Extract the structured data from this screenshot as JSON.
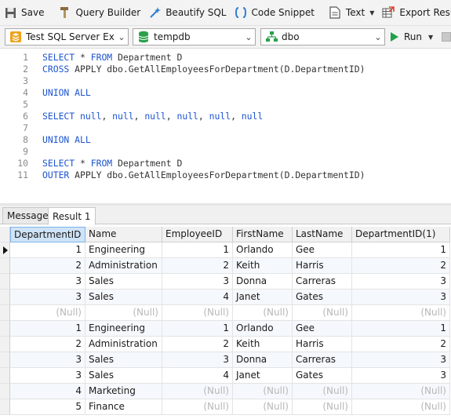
{
  "toolbar": {
    "save": "Save",
    "query_builder": "Query Builder",
    "beautify": "Beautify SQL",
    "code_snippet": "Code Snippet",
    "text": "Text",
    "export_result": "Export Result"
  },
  "connection": {
    "server": "Test SQL Server Expres",
    "database": "tempdb",
    "schema": "dbo",
    "run": "Run"
  },
  "editor": {
    "lines": [
      {
        "n": "1",
        "code": "SELECT * FROM Department D"
      },
      {
        "n": "2",
        "code": "CROSS APPLY dbo.GetAllEmployeesForDepartment(D.DepartmentID)"
      },
      {
        "n": "3",
        "code": ""
      },
      {
        "n": "4",
        "code": "UNION ALL"
      },
      {
        "n": "5",
        "code": ""
      },
      {
        "n": "6",
        "code": "SELECT null, null, null, null, null, null"
      },
      {
        "n": "7",
        "code": ""
      },
      {
        "n": "8",
        "code": "UNION ALL"
      },
      {
        "n": "9",
        "code": ""
      },
      {
        "n": "10",
        "code": "SELECT * FROM Department D"
      },
      {
        "n": "11",
        "code": "OUTER APPLY dbo.GetAllEmployeesForDepartment(D.DepartmentID)"
      }
    ]
  },
  "tabs": {
    "message": "Message",
    "result": "Result 1"
  },
  "grid": {
    "columns": [
      "DepartmentID",
      "Name",
      "EmployeeID",
      "FirstName",
      "LastName",
      "DepartmentID(1)"
    ],
    "rows": [
      [
        "1",
        "Engineering",
        "1",
        "Orlando",
        "Gee",
        "1"
      ],
      [
        "2",
        "Administration",
        "2",
        "Keith",
        "Harris",
        "2"
      ],
      [
        "3",
        "Sales",
        "3",
        "Donna",
        "Carreras",
        "3"
      ],
      [
        "3",
        "Sales",
        "4",
        "Janet",
        "Gates",
        "3"
      ],
      [
        "(Null)",
        "(Null)",
        "(Null)",
        "(Null)",
        "(Null)",
        "(Null)"
      ],
      [
        "1",
        "Engineering",
        "1",
        "Orlando",
        "Gee",
        "1"
      ],
      [
        "2",
        "Administration",
        "2",
        "Keith",
        "Harris",
        "2"
      ],
      [
        "3",
        "Sales",
        "3",
        "Donna",
        "Carreras",
        "3"
      ],
      [
        "3",
        "Sales",
        "4",
        "Janet",
        "Gates",
        "3"
      ],
      [
        "4",
        "Marketing",
        "(Null)",
        "(Null)",
        "(Null)",
        "(Null)"
      ],
      [
        "5",
        "Finance",
        "(Null)",
        "(Null)",
        "(Null)",
        "(Null)"
      ]
    ]
  },
  "colors": {
    "keyword": "#1c54d0",
    "null_text": "#b7b7b7",
    "run_green": "#21a147"
  }
}
